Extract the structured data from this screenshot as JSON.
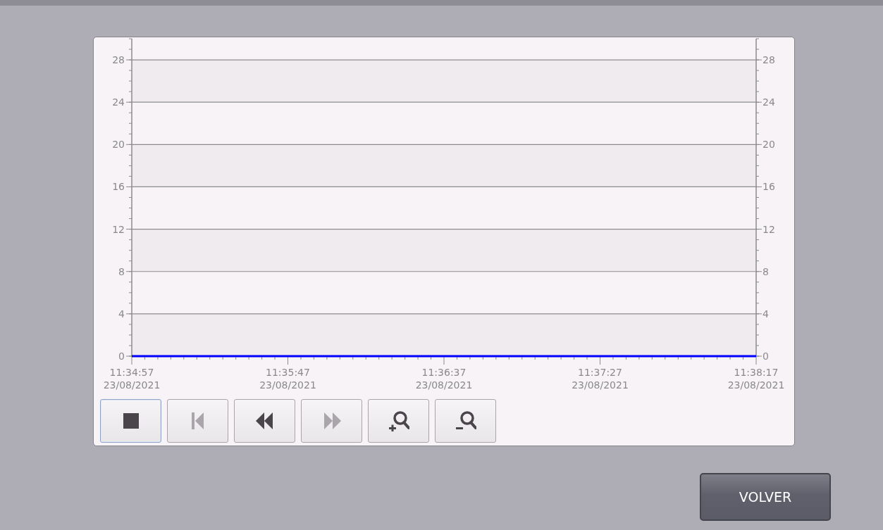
{
  "trend": {
    "chart_data": {
      "type": "line",
      "categories": [
        "11:34:57 23/08/2021",
        "11:35:47 23/08/2021",
        "11:36:37 23/08/2021",
        "11:37:27 23/08/2021",
        "11:38:17 23/08/2021"
      ],
      "series": [
        {
          "color": "#0000ff",
          "values": [
            0,
            0,
            0,
            0,
            0
          ]
        }
      ],
      "ylim": [
        0,
        30
      ],
      "yticks": [
        0,
        4,
        8,
        12,
        16,
        20,
        24,
        28
      ],
      "y2ticks": [
        0,
        4,
        8,
        12,
        16,
        20,
        24,
        28
      ],
      "y2lim": [
        0,
        30
      ],
      "grid": true
    },
    "buttons": [
      {
        "kind": "stop",
        "selected": true,
        "disabled": false
      },
      {
        "kind": "first",
        "selected": false,
        "disabled": true
      },
      {
        "kind": "rewind",
        "selected": false,
        "disabled": false
      },
      {
        "kind": "forward",
        "selected": false,
        "disabled": true
      },
      {
        "kind": "zoom_in",
        "selected": false,
        "disabled": false
      },
      {
        "kind": "zoom_out",
        "selected": false,
        "disabled": false
      }
    ]
  },
  "back_button": {
    "label": "VOLVER"
  }
}
